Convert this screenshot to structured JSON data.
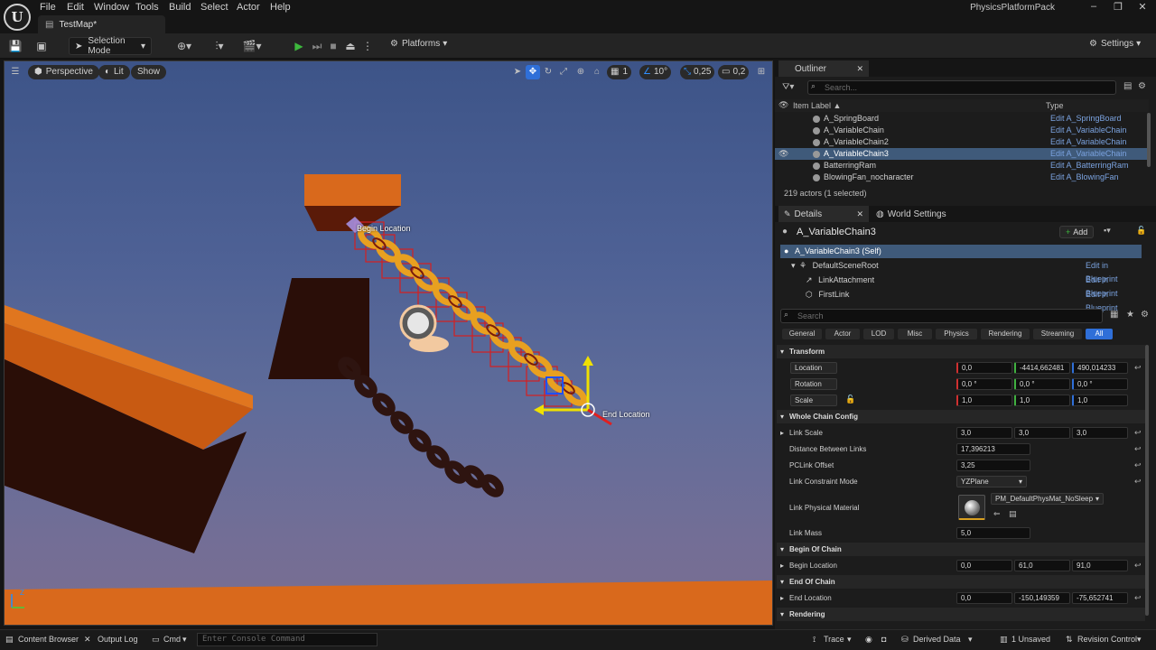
{
  "titlebar": {
    "logo": "U",
    "menu": [
      "File",
      "Edit",
      "Window",
      "Tools",
      "Build",
      "Select",
      "Actor",
      "Help"
    ],
    "app_title": "PhysicsPlatformPack",
    "level_tab": "TestMap*"
  },
  "toolbar": {
    "selection_mode": "Selection Mode",
    "platforms": "Platforms",
    "settings": "Settings"
  },
  "viewport": {
    "perspective": "Perspective",
    "lit": "Lit",
    "show": "Show",
    "grid_value": "1",
    "rotation_snap": "10°",
    "scale_snap": "0,25",
    "camera_speed": "0,2",
    "begin_label": "Begin Location",
    "end_label": "End Location",
    "axis_z": "Z"
  },
  "outliner": {
    "tab": "Outliner",
    "search_placeholder": "Search...",
    "col_label": "Item Label ▲",
    "col_type": "Type",
    "rows": [
      {
        "name": "A_SpringBoard",
        "type": "Edit A_SpringBoard"
      },
      {
        "name": "A_VariableChain",
        "type": "Edit A_VariableChain"
      },
      {
        "name": "A_VariableChain2",
        "type": "Edit A_VariableChain"
      },
      {
        "name": "A_VariableChain3",
        "type": "Edit A_VariableChain"
      },
      {
        "name": "BatterringRam",
        "type": "Edit A_BatterringRam"
      },
      {
        "name": "BlowingFan_nocharacter",
        "type": "Edit A_BlowingFan"
      }
    ],
    "count": "219 actors (1 selected)"
  },
  "details": {
    "tab": "Details",
    "world_tab": "World Settings",
    "actor_name": "A_VariableChain3",
    "add_label": "Add",
    "components": [
      {
        "name": "A_VariableChain3 (Self)",
        "link": ""
      },
      {
        "name": "DefaultSceneRoot",
        "link": "Edit in Blueprint"
      },
      {
        "name": "LinkAttachment",
        "link": "Edit in Blueprint"
      },
      {
        "name": "FirstLink",
        "link": "Edit in Blueprint"
      }
    ],
    "search_placeholder": "Search",
    "filters": [
      "General",
      "Actor",
      "LOD",
      "Misc",
      "Physics",
      "Rendering",
      "Streaming",
      "All"
    ],
    "transform": {
      "title": "Transform",
      "location_label": "Location",
      "location": [
        "0,0",
        "-4414,662481",
        "490,014233"
      ],
      "rotation_label": "Rotation",
      "rotation": [
        "0,0 °",
        "0,0 °",
        "0,0 °"
      ],
      "scale_label": "Scale",
      "scale": [
        "1,0",
        "1,0",
        "1,0"
      ]
    },
    "chain": {
      "title": "Whole Chain Config",
      "link_scale_label": "Link Scale",
      "link_scale": [
        "3,0",
        "3,0",
        "3,0"
      ],
      "distance_label": "Distance Between Links",
      "distance": "17,396213",
      "pclink_label": "PCLink Offset",
      "pclink": "3,25",
      "constraint_label": "Link Constraint Mode",
      "constraint": "YZPlane",
      "material_label": "Link Physical Material",
      "material": "PM_DefaultPhysMat_NoSleep",
      "mass_label": "Link Mass",
      "mass": "5,0"
    },
    "begin": {
      "title": "Begin Of Chain",
      "label": "Begin Location",
      "values": [
        "0,0",
        "61,0",
        "91,0"
      ]
    },
    "end": {
      "title": "End Of Chain",
      "label": "End Location",
      "values": [
        "0,0",
        "-150,149359",
        "-75,652741"
      ]
    },
    "rendering": "Rendering"
  },
  "bottom": {
    "content_browser": "Content Browser",
    "output_log": "Output Log",
    "cmd": "Cmd",
    "console_placeholder": "Enter Console Command",
    "trace": "Trace",
    "derived_data": "Derived Data",
    "unsaved": "1 Unsaved",
    "revision": "Revision Control"
  },
  "colors": {
    "accent": "#2f6fd8",
    "orange": "#d9691c",
    "selection": "#3f5a7a"
  }
}
